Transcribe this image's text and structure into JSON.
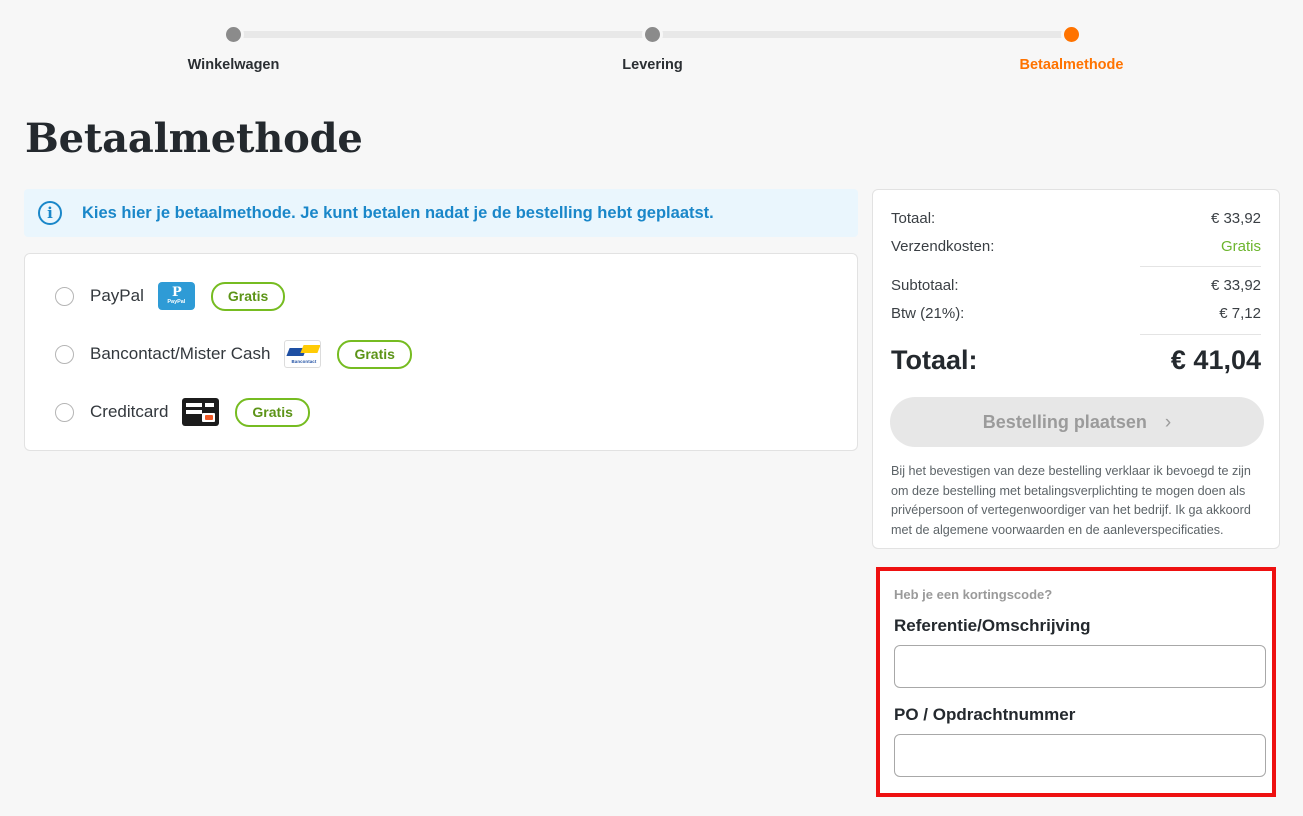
{
  "stepper": {
    "steps": [
      {
        "label": "Winkelwagen",
        "state": "done"
      },
      {
        "label": "Levering",
        "state": "done"
      },
      {
        "label": "Betaalmethode",
        "state": "active"
      }
    ],
    "active_color": "#ff7300",
    "done_color": "#8b8b8b",
    "track_color": "#e8e8e8"
  },
  "page": {
    "title": "Betaalmethode"
  },
  "notice": {
    "icon": "info-circle-icon",
    "text": "Kies hier je betaalmethode. Je kunt betalen nadat je de bestelling hebt geplaatst.",
    "color": "#1a87c9",
    "background": "#eaf6fd"
  },
  "payment_methods": {
    "items": [
      {
        "label": "PayPal",
        "logo": "paypal-logo",
        "price_label": "Gratis",
        "selected": false
      },
      {
        "label": "Bancontact/Mister Cash",
        "logo": "bancontact-logo",
        "price_label": "Gratis",
        "selected": false
      },
      {
        "label": "Creditcard",
        "logo": "creditcard-logo",
        "price_label": "Gratis",
        "selected": false
      }
    ],
    "pill_color": "#76bc21"
  },
  "paypal_logo": {
    "mark": "P",
    "word": "PayPal"
  },
  "bancontact_logo": {
    "word": "Bancontact"
  },
  "summary": {
    "rows": [
      {
        "label": "Totaal:",
        "value": "€ 33,92"
      },
      {
        "label": "Verzendkosten:",
        "value": "Gratis"
      },
      {
        "label": "Subtotaal:",
        "value": "€ 33,92"
      },
      {
        "label": "Btw (21%):",
        "value": "€ 7,12"
      }
    ],
    "total_label": "Totaal:",
    "total_value": "€ 41,04",
    "free_color": "#6cb52d",
    "order_button": {
      "label": "Bestelling plaatsen",
      "chevron": "›",
      "enabled": false
    },
    "legal_text": "Bij het bevestigen van deze bestelling verklaar ik bevoegd te zijn om deze bestelling met betalingsverplichting te mogen doen als privépersoon of vertegenwoordiger van het bedrijf. Ik ga akkoord met de algemene voorwaarden en de aanleverspecificaties."
  },
  "coupon_panel": {
    "highlight_color": "#ee1111",
    "coupon_link": "Heb je een kortingscode?",
    "reference": {
      "label": "Referentie/Omschrijving",
      "value": "",
      "placeholder": ""
    },
    "po_number": {
      "label": "PO / Opdrachtnummer",
      "value": "",
      "placeholder": ""
    }
  }
}
